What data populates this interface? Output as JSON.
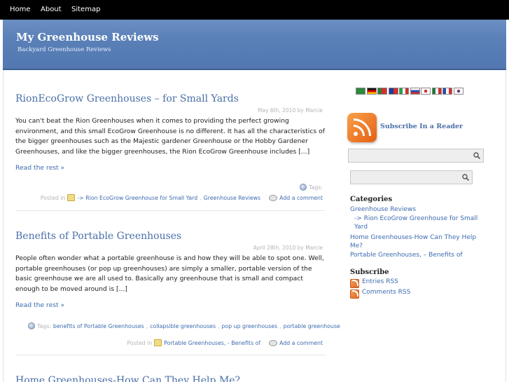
{
  "nav": {
    "items": [
      "Home",
      "About",
      "Sitemap"
    ]
  },
  "header": {
    "title": "My Greenhouse Reviews",
    "tagline": "Backyard Greenhouse Reviews"
  },
  "posts": [
    {
      "title": "RionEcoGrow Greenhouses – for Small Yards",
      "date": "May 6th, 2010 by",
      "author": "Marcie",
      "body": "You can't beat the Rion Greenhouses when it comes to providing the perfect growing environment, and this small EcoGrow Greenhouse is no different. It has all the characteristics of the bigger greenhouses such as the Majestic gardener Greenhouse or the Hobby Gardener Greenhouses, and like the bigger greenhouses, the Rion EcoGrow Greenhouse includes [...]",
      "read_more": "Read the rest »",
      "tags_label": "Tags:",
      "posted_in_label": "Posted in",
      "categories": [
        "-> Rion EcoGrow Greenhouse for Small Yard",
        "Greenhouse Reviews"
      ],
      "add_comment": "Add a comment"
    },
    {
      "title": "Benefits of Portable Greenhouses",
      "date": "April 28th, 2010 by",
      "author": "Marcie",
      "body": "People often wonder what a portable greenhouse is and how they will be able to spot one. Well, portable greenhouses (or pop up greenhouses) are simply a smaller, portable version of the basic greenhouse we are all used to. Basically any greenhouse that is small and compact enough to be moved around is [...]",
      "read_more": "Read the rest »",
      "tags_label": "Tags:",
      "tags": [
        "benefits of Portable Greenhouses",
        "collapsible greenhouses",
        "pop up greenhouses",
        "portable greenhouse"
      ],
      "posted_in_label": "Posted in",
      "categories": [
        "Portable Greenhouses, - Benefits of"
      ],
      "add_comment": "Add a comment"
    },
    {
      "title": "Home Greenhouses-How Can They Help Me?"
    }
  ],
  "sidebar": {
    "subscribe_reader": "Subscribe In a Reader",
    "categories_title": "Categories",
    "categories": [
      "Greenhouse Reviews",
      "-> Rion EcoGrow Greenhouse for Small Yard",
      "Home Greenhouses-How Can They Help Me?",
      "Portable Greenhouses, – Benefits of"
    ],
    "subscribe_title": "Subscribe",
    "entries_rss": "Entries RSS",
    "comments_rss": "Comments RSS"
  },
  "flags": [
    {
      "name": "saudi-arabia-flag",
      "color": "#2c8a3c"
    },
    {
      "name": "germany-flag",
      "color": "#d4a017"
    },
    {
      "name": "portugal-flag",
      "color": "#2e7d32"
    },
    {
      "name": "taiwan-flag",
      "color": "#d32f2f"
    },
    {
      "name": "italy-flag",
      "color": "#4caf50"
    },
    {
      "name": "russia-flag",
      "color": "#3f51b5"
    },
    {
      "name": "japan-flag",
      "color": "#ffffff"
    },
    {
      "name": "mexico-flag",
      "color": "#2e7d32"
    },
    {
      "name": "france-flag",
      "color": "#3f51b5"
    },
    {
      "name": "korea-flag",
      "color": "#ffffff"
    }
  ]
}
